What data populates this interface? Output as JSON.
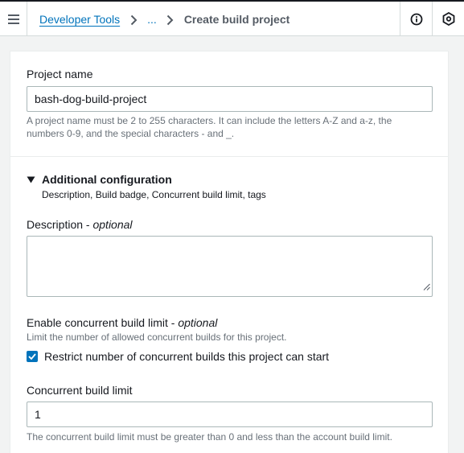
{
  "header": {
    "breadcrumb": [
      "Developer Tools",
      "...",
      "Create build project"
    ]
  },
  "form": {
    "project_name": {
      "label": "Project name",
      "value": "bash-dog-build-project",
      "hint_line1": "A project name must be 2 to 255 characters. It can include the letters A-Z and a-z, the",
      "hint_line2": "numbers 0-9, and the special characters - and _."
    },
    "additional": {
      "title": "Additional configuration",
      "subtitle": "Description, Build badge, Concurrent build limit, tags",
      "expanded": true
    },
    "description": {
      "label": "Description",
      "optional": "optional",
      "separator": " - ",
      "value": ""
    },
    "concurrent": {
      "label": "Enable concurrent build limit",
      "optional": "optional",
      "separator": " - ",
      "hint": "Limit the number of allowed concurrent builds for this project.",
      "checkbox_label": "Restrict number of concurrent builds this project can start",
      "checked": true
    },
    "limit": {
      "label": "Concurrent build limit",
      "value": "1",
      "hint": "The concurrent build limit must be greater than 0 and less than the account build limit."
    }
  },
  "colors": {
    "link": "#0073bb",
    "checkbox": "#0073bb",
    "page_bg": "#f2f3f3"
  },
  "icons": [
    "menu-icon",
    "chevron-right-icon",
    "info-icon",
    "settings-hex-icon",
    "caret-down-icon",
    "checkmark-icon",
    "resize-grip-icon"
  ]
}
